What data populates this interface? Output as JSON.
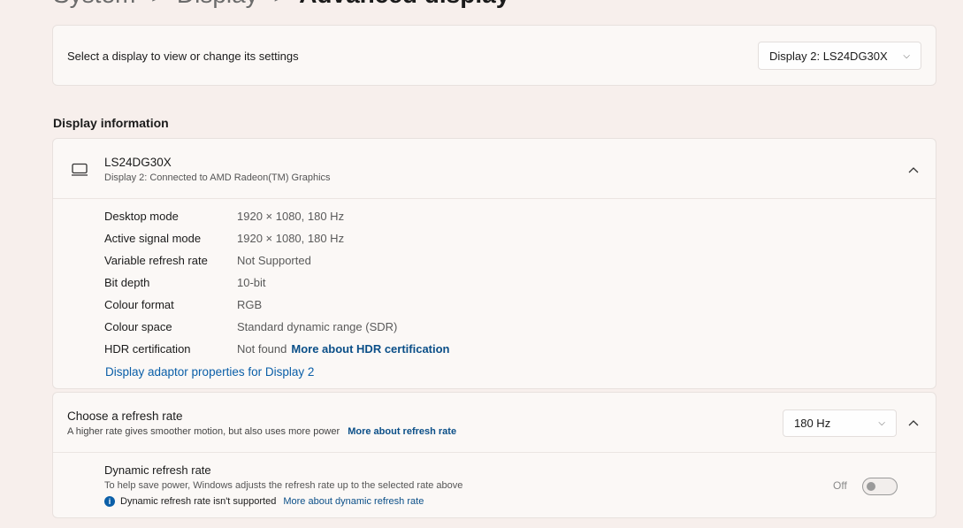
{
  "breadcrumb": {
    "items": [
      "System",
      "Display"
    ],
    "separator": ">",
    "current": "Advanced display"
  },
  "selector": {
    "label": "Select a display to view or change its settings",
    "value": "Display 2: LS24DG30X"
  },
  "display_info": {
    "section_title": "Display information",
    "name": "LS24DG30X",
    "subtitle": "Display 2: Connected to AMD Radeon(TM) Graphics",
    "rows": [
      {
        "key": "Desktop mode",
        "value": "1920 × 1080, 180 Hz"
      },
      {
        "key": "Active signal mode",
        "value": "1920 × 1080, 180 Hz"
      },
      {
        "key": "Variable refresh rate",
        "value": "Not Supported"
      },
      {
        "key": "Bit depth",
        "value": "10-bit"
      },
      {
        "key": "Colour format",
        "value": "RGB"
      },
      {
        "key": "Colour space",
        "value": "Standard dynamic range (SDR)"
      },
      {
        "key": "HDR certification",
        "value": "Not found",
        "link": "More about HDR certification"
      }
    ],
    "adaptor_link": "Display adaptor properties for Display 2"
  },
  "refresh": {
    "title": "Choose a refresh rate",
    "subtitle": "A higher rate gives smoother motion, but also uses more power",
    "subtitle_link": "More about refresh rate",
    "value": "180 Hz",
    "dynamic": {
      "title": "Dynamic refresh rate",
      "subtitle": "To help save power, Windows adjusts the refresh rate up to the selected rate above",
      "note": "Dynamic refresh rate isn't supported",
      "note_link": "More about dynamic refresh rate",
      "toggle_label": "Off",
      "toggle_on": false
    }
  }
}
